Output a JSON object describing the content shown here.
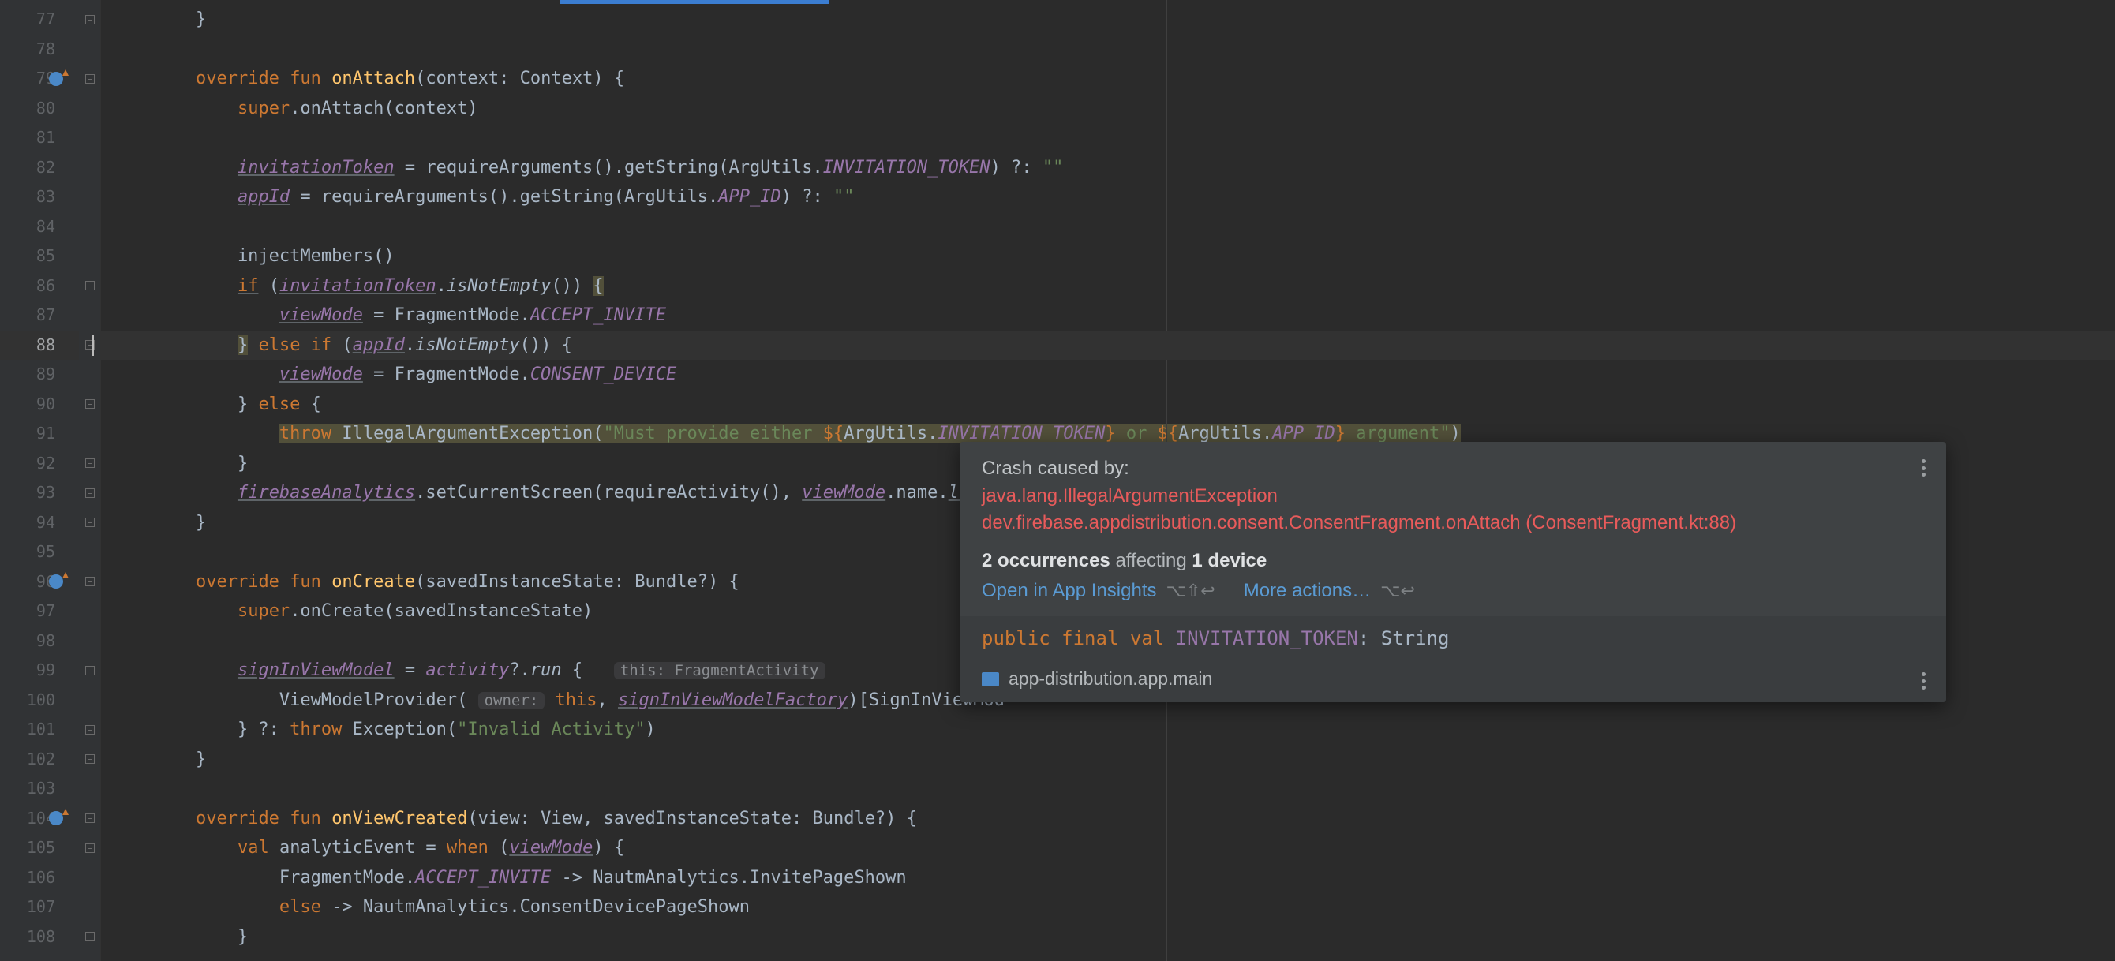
{
  "gutter": {
    "start": 77,
    "end": 108,
    "override_markers": [
      79,
      96,
      104
    ]
  },
  "fold_markers": [
    77,
    79,
    86,
    88,
    90,
    92,
    93,
    94,
    96,
    99,
    101,
    102,
    104,
    105,
    108
  ],
  "current_line": 88,
  "code": {
    "l77": "        }",
    "l78": "",
    "l79a": "        ",
    "l79_ov": "override",
    "l79b": " ",
    "l79_fun": "fun",
    "l79c": " ",
    "l79_fn": "onAttach",
    "l79d": "(context: Context) {",
    "l80a": "            ",
    "l80_sup": "super",
    "l80b": ".onAttach(context)",
    "l81": "",
    "l82a": "            ",
    "l82_tok": "invitationToken",
    "l82b": " = requireArguments().getString(ArgUtils.",
    "l82_c": "INVITATION_TOKEN",
    "l82c": ") ?: ",
    "l82_s": "\"\"",
    "l83a": "            ",
    "l83_tok": "appId",
    "l83b": " = requireArguments().getString(ArgUtils.",
    "l83_c": "APP_ID",
    "l83c": ") ?: ",
    "l83_s": "\"\"",
    "l84": "",
    "l85": "            injectMembers()",
    "l86a": "            ",
    "l86_if": "if",
    "l86b": " (",
    "l86_tok": "invitationToken",
    "l86c": ".",
    "l86_fn": "isNotEmpty",
    "l86d": "()) ",
    "l86_br": "{",
    "l87a": "                ",
    "l87_vm": "viewMode",
    "l87b": " = FragmentMode.",
    "l87_c": "ACCEPT_INVITE",
    "l88a": "            ",
    "l88_br1": "}",
    "l88b": " ",
    "l88_else": "else",
    "l88c": " ",
    "l88_if": "if",
    "l88d": " (",
    "l88_tok": "appId",
    "l88e": ".",
    "l88_fn": "isNotEmpty",
    "l88f": "()) {",
    "l89a": "                ",
    "l89_vm": "viewMode",
    "l89b": " = FragmentMode.",
    "l89_c": "CONSENT_DEVICE",
    "l90a": "            } ",
    "l90_else": "else",
    "l90b": " {",
    "l91a": "                ",
    "l91_throw": "throw",
    "l91b": " IllegalArgumentException(",
    "l91_s1": "\"Must provide either ",
    "l91_d1": "${",
    "l91_e1a": "ArgUtils.",
    "l91_e1b": "INVITATION_TOKEN",
    "l91_d1c": "}",
    "l91_s2": " or ",
    "l91_d2": "${",
    "l91_e2a": "ArgUtils.",
    "l91_e2b": "APP_ID",
    "l91_d2c": "}",
    "l91_s3": " argument\"",
    "l91_end": ")",
    "l92": "            }",
    "l93a": "            ",
    "l93_fa": "firebaseAnalytics",
    "l93b": ".setCurrentScreen(requireActivity(), ",
    "l93_vm": "viewMode",
    "l93c": ".name.",
    "l93_low": "lowe",
    "l94": "        }",
    "l95": "",
    "l96a": "        ",
    "l96_ov": "override",
    "l96b": " ",
    "l96_fun": "fun",
    "l96c": " ",
    "l96_fn": "onCreate",
    "l96d": "(savedInstanceState: Bundle?) {",
    "l97a": "            ",
    "l97_sup": "super",
    "l97b": ".onCreate(savedInstanceState)",
    "l98": "",
    "l99a": "            ",
    "l99_vm": "signInViewModel",
    "l99b": " = ",
    "l99_act": "activity",
    "l99c": "?.",
    "l99_run": "run",
    "l99d": " {   ",
    "l99_hint": "this: FragmentActivity",
    "l100a": "                ViewModelProvider( ",
    "l100_hint": "owner:",
    "l100b": " ",
    "l100_this": "this",
    "l100c": ", ",
    "l100_fac": "signInViewModelFactory",
    "l100d": ")[SignInViewMod",
    "l101a": "            } ?: ",
    "l101_throw": "throw",
    "l101b": " Exception(",
    "l101_s": "\"Invalid Activity\"",
    "l101c": ")",
    "l102": "        }",
    "l103": "",
    "l104a": "        ",
    "l104_ov": "override",
    "l104b": " ",
    "l104_fun": "fun",
    "l104c": " ",
    "l104_fn": "onViewCreated",
    "l104d": "(view: View, savedInstanceState: Bundle?) {",
    "l105a": "            ",
    "l105_val": "val",
    "l105b": " analyticEvent = ",
    "l105_when": "when",
    "l105c": " (",
    "l105_vm": "viewMode",
    "l105d": ") {",
    "l106a": "                FragmentMode.",
    "l106_c": "ACCEPT_INVITE",
    "l106b": " -> NautmAnalytics.InvitePageShown",
    "l107a": "                ",
    "l107_else": "else",
    "l107b": " -> NautmAnalytics.ConsentDevicePageShown",
    "l108": "            }"
  },
  "popup": {
    "title": "Crash caused by:",
    "exception": "java.lang.IllegalArgumentException",
    "location": "dev.firebase.appdistribution.consent.ConsentFragment.onAttach (ConsentFragment.kt:88)",
    "occ_count": "2",
    "occ_label": "occurrences",
    "aff_label": "affecting",
    "dev_count": "1",
    "dev_label": "device",
    "link_open": "Open in App Insights",
    "kbd_open": "⌥⇧↩",
    "link_more": "More actions…",
    "kbd_more": "⌥↩",
    "decl": "public final val INVITATION_TOKEN: String",
    "module": "app-distribution.app.main"
  }
}
